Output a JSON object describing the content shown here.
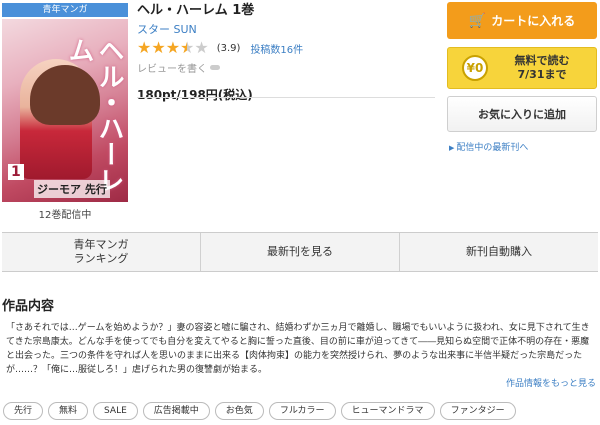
{
  "cover": {
    "badge": "青年マンガ",
    "title_art": "ヘル・ハーレム",
    "volume": "1",
    "author_art": "ジーモア 先行",
    "caption": "12巻配信中"
  },
  "info": {
    "title": "ヘル・ハーレム 1巻",
    "author": "スター SUN",
    "rating": 3.9,
    "rating_text": "(3.9)",
    "posts": "投稿数16件",
    "review_link": "レビューを書く",
    "price": "180pt/198円(税込)"
  },
  "actions": {
    "cart": "カートに入れる",
    "free_coin": "¥0",
    "free_line1": "無料で読む",
    "free_line2": "7/31まで",
    "favorite": "お気に入りに追加",
    "latest": "配信中の最新刊へ"
  },
  "nav": [
    {
      "label": "青年マンガ\nランキング"
    },
    {
      "label": "最新刊を見る"
    },
    {
      "label": "新刊自動購入"
    }
  ],
  "content": {
    "heading": "作品内容",
    "description": "「さあそれでは…ゲームを始めようか？」妻の容姿と嘘に騙され、結婚わずか三ヵ月で離婚し、職場でもいいように扱われ、女に見下されて生きてきた宗島康太。どんな手を使ってでも自分を変えてやると胸に誓った直後、目の前に車が迫ってきて――見知らぬ空間で正体不明の存在・悪魔と出会った。三つの条件を守れば人を思いのままに出来る【肉体拘束】の能力を突然授けられ、夢のような出来事に半信半疑だった宗島だったが……？「俺に…服従しろ！」虐げられた男の復讐劇が始まる。",
    "more": "作品情報をもっと見る"
  },
  "tags": [
    "先行",
    "無料",
    "SALE",
    "広告掲載中",
    "お色気",
    "フルカラー",
    "ヒューマンドラマ",
    "ファンタジー"
  ],
  "colors": {
    "accent_blue": "#3c7fc4",
    "cart_orange": "#f39c1b",
    "free_yellow": "#f7d43b",
    "star": "#f5a623"
  }
}
